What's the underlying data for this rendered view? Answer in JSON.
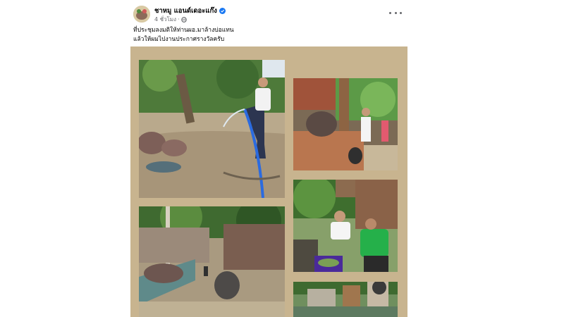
{
  "post": {
    "author": "ชาหมู แอนด์เดอะแก๊ง",
    "timestamp": "4 ชั่วโมง",
    "separator": "·",
    "caption_lines": [
      "ที่ประชุมลงมติให้ท่านผอ.มาล้างบ่อแทน",
      "แล้วให้ผมไปงานประกาศรางวัลครับ"
    ]
  },
  "icons": {
    "verified": "verified-badge-icon",
    "privacy": "globe-icon",
    "more": "more-options-icon"
  },
  "colors": {
    "verified_blue": "#1877f2",
    "meta_gray": "#65676b",
    "collage_background": "#c8b48f"
  },
  "photos": [
    {
      "name": "photo-hose-cleaning",
      "scene": "man hosing ground near hippos"
    },
    {
      "name": "photo-hippo-enclosure-wood",
      "scene": "hippo standing by wooden wall with visitors"
    },
    {
      "name": "photo-hippos-fence",
      "scene": "two hippos near a fence"
    },
    {
      "name": "photo-two-men-bucket",
      "scene": "two men preparing food buckets"
    },
    {
      "name": "photo-enclosure-partial",
      "scene": "partial view of enclosure gate"
    }
  ]
}
